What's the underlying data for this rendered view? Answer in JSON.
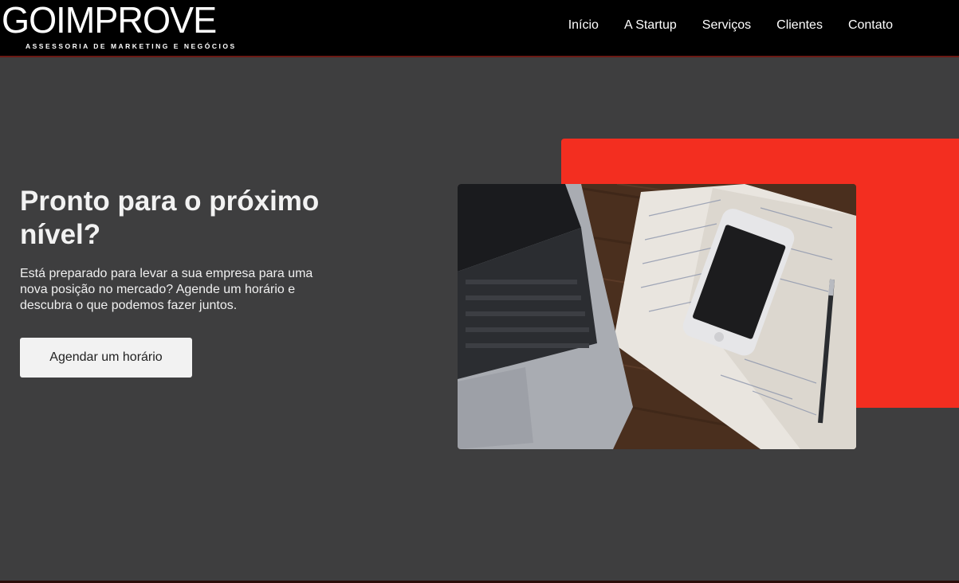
{
  "header": {
    "logo_text": "GOIMPROVE",
    "logo_tagline": "ASSESSORIA DE MARKETING E NEGÓCIOS",
    "nav": [
      {
        "label": "Início"
      },
      {
        "label": "A Startup"
      },
      {
        "label": "Serviços"
      },
      {
        "label": "Clientes"
      },
      {
        "label": "Contato"
      }
    ]
  },
  "hero": {
    "title": "Pronto para o próximo nível?",
    "text": "Está preparado para levar a sua empresa para uma nova posição no mercado? Agende um horário e descubra o que podemos fazer juntos.",
    "cta_label": "Agendar um horário"
  },
  "colors": {
    "header_bg": "#000000",
    "page_bg": "#3e3e3f",
    "accent_red": "#f32e20",
    "button_bg": "#f2f2f2"
  }
}
